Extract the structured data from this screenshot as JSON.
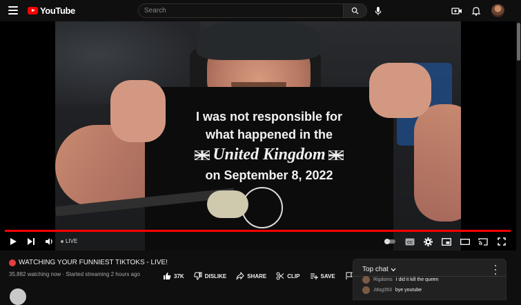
{
  "header": {
    "logo_text": "YouTube",
    "search_placeholder": "Search",
    "brand_color": "#ff0000"
  },
  "player": {
    "shirt_text": {
      "line1": "I was not responsible for",
      "line2": "what happened in the",
      "line3": "United Kingdom",
      "line4": "on September 8, 2022"
    },
    "live_label": "LIVE",
    "progress_fraction": 1.0
  },
  "video": {
    "title": "WATCHING YOUR FUNNIEST TIKTOKS - LIVE!",
    "meta": "35,882 watching now · Started streaming 2 hours ago"
  },
  "actions": {
    "like_count": "37K",
    "dislike_label": "DISLIKE",
    "share_label": "SHARE",
    "clip_label": "CLIP",
    "save_label": "SAVE"
  },
  "chat": {
    "header_label": "Top chat",
    "messages": [
      {
        "author": "Rigdoms",
        "text": "I did it kill the queen"
      },
      {
        "author": "Jdog353",
        "text": "bye youtube"
      }
    ]
  }
}
